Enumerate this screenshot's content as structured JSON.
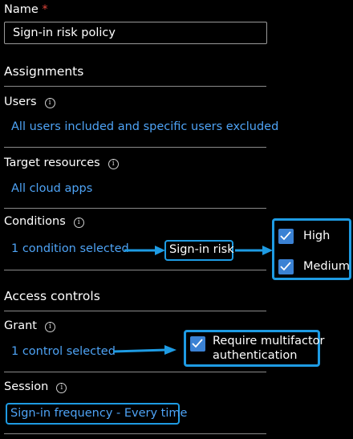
{
  "name_field": {
    "label": "Name",
    "required_mark": "*",
    "value": "Sign-in risk policy"
  },
  "assignments": {
    "heading": "Assignments",
    "users": {
      "label": "Users",
      "link": "All users included and specific users excluded"
    },
    "target_resources": {
      "label": "Target resources",
      "link": "All cloud apps"
    },
    "conditions": {
      "label": "Conditions",
      "link": "1 condition selected",
      "callout": "Sign-in risk",
      "levels": [
        {
          "label": "High",
          "checked": true
        },
        {
          "label": "Medium",
          "checked": true
        }
      ]
    }
  },
  "access_controls": {
    "heading": "Access controls",
    "grant": {
      "label": "Grant",
      "link": "1 control selected",
      "callout_line1": "Require multifactor",
      "callout_line2": "authentication",
      "checked": true
    },
    "session": {
      "label": "Session",
      "link": "Sign-in frequency - Every time"
    }
  },
  "info_icon_glyph": "i",
  "colors": {
    "link": "#4ea3f5",
    "highlight": "#1e9be3",
    "checkbox": "#3b82d4",
    "required": "#e2463a"
  }
}
